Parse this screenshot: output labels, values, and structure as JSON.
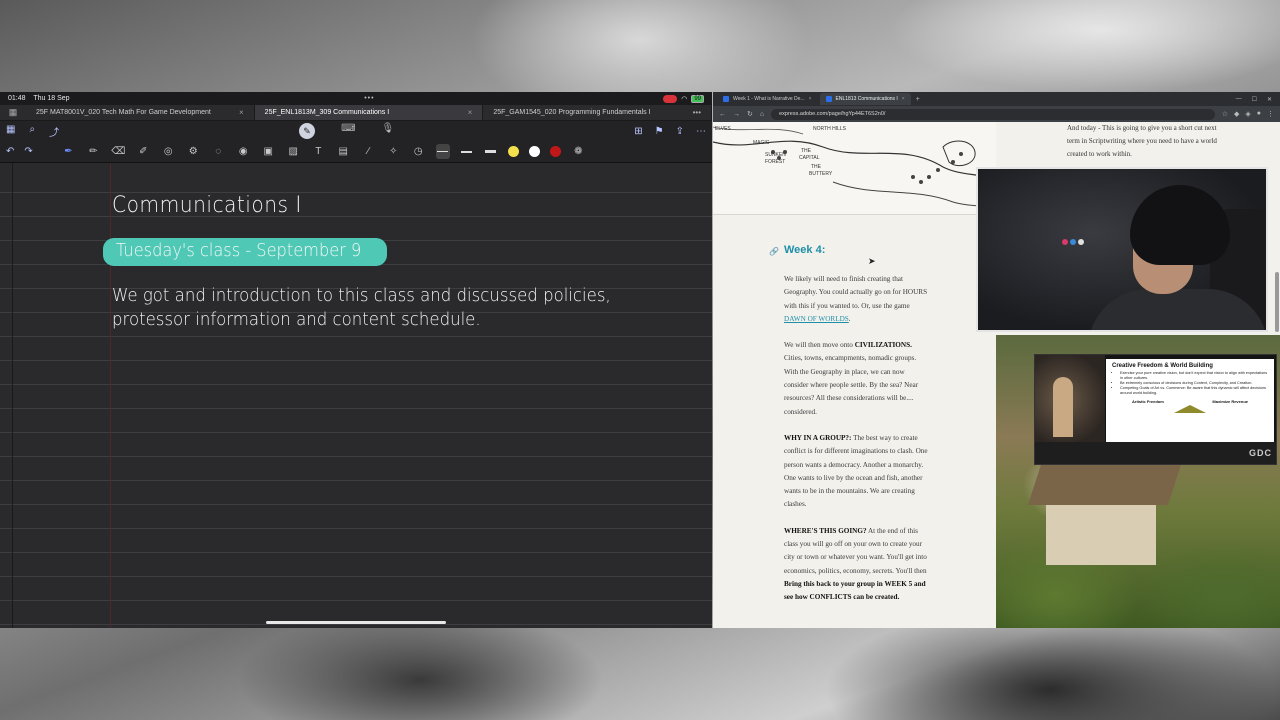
{
  "status_bar": {
    "time": "01:48",
    "date": "Thu 18 Sep",
    "battery": "99"
  },
  "notes_tabs": [
    {
      "label": "25F MAT8001V_020 Tech Math For Game Development"
    },
    {
      "label": "25F_ENL1813M_309 Communications I"
    },
    {
      "label": "25F_GAM1545_020 Programming Fundamentals I"
    }
  ],
  "note": {
    "title": "Communications I",
    "highlight": "Tuesday's class - September 9",
    "body": "We got and introduction to this class and discussed policies, protessor information and content schedule."
  },
  "colors": {
    "highlight": "#4fc9b6",
    "accent_link": "#1f8fa8",
    "swatch_yellow": "#f4e04d",
    "swatch_white": "#ffffff",
    "swatch_red": "#c01818"
  },
  "browser": {
    "tabs": [
      {
        "label": "Week 1 - What is Narrative De..."
      },
      {
        "label": "ENL1813 Communications I"
      }
    ],
    "url": "express.adobe.com/page/hgYp44ET6S2n0/"
  },
  "article": {
    "heading": "Week 4:",
    "side_text": "And today - This is going to give you a short cut next term in Scriptwriting where you need to have a world created to work within.",
    "p1_text": "We likely will need to finish creating that Geography. You could actually go on for HOURS with this if you wanted to. Or, use the game ",
    "p1_link": "DAWN OF WORLDS",
    "p2_lead": "We will then move onto ",
    "p2_bold": "CIVILIZATIONS.",
    "p2_text": " Cities, towns, encampments, nomadic groups. With the Geography in place, we can now consider where people settle. By the sea? Near resources? All these considerations will be.... considered.",
    "p3_bold": "WHY IN A GROUP?:",
    "p3_text": " The best way to create conflict is for different imaginations to clash. One person wants a democracy. Another a monarchy. One wants to live by the ocean and fish, another wants to be in the mountains. We are creating clashes.",
    "p4_bold": "WHERE'S THIS GOING?",
    "p4_text": " At the end of this class you will go off on your own to create your city or town or whatever you want. You'll get into economics, politics, economy, secrets. You'll then ",
    "p4_bold2": "Bring this back to your group in WEEK 5 and see how CONFLICTS can be created."
  },
  "slide": {
    "title": "Creative Freedom & World Building",
    "bullets": [
      "Exercise your pure creative vision, but don't expect that vision to align with expectations in other cultures.",
      "Be extremely conscious of decisions during Context, Complexity, and Creation.",
      "Competing Goals of Art vs. Commerce: Be aware that this dynamic will affect decisions around world building."
    ],
    "left_label": "Artistic Freedom",
    "right_label": "Maximize Revenue",
    "logo": "GDC"
  },
  "map": {
    "labels": [
      "ELVES",
      "NORTH HILLS",
      "MAGIC",
      "SUNKEN",
      "FOREST",
      "THE",
      "CAPITAL",
      "THE",
      "BUTTERY"
    ]
  }
}
